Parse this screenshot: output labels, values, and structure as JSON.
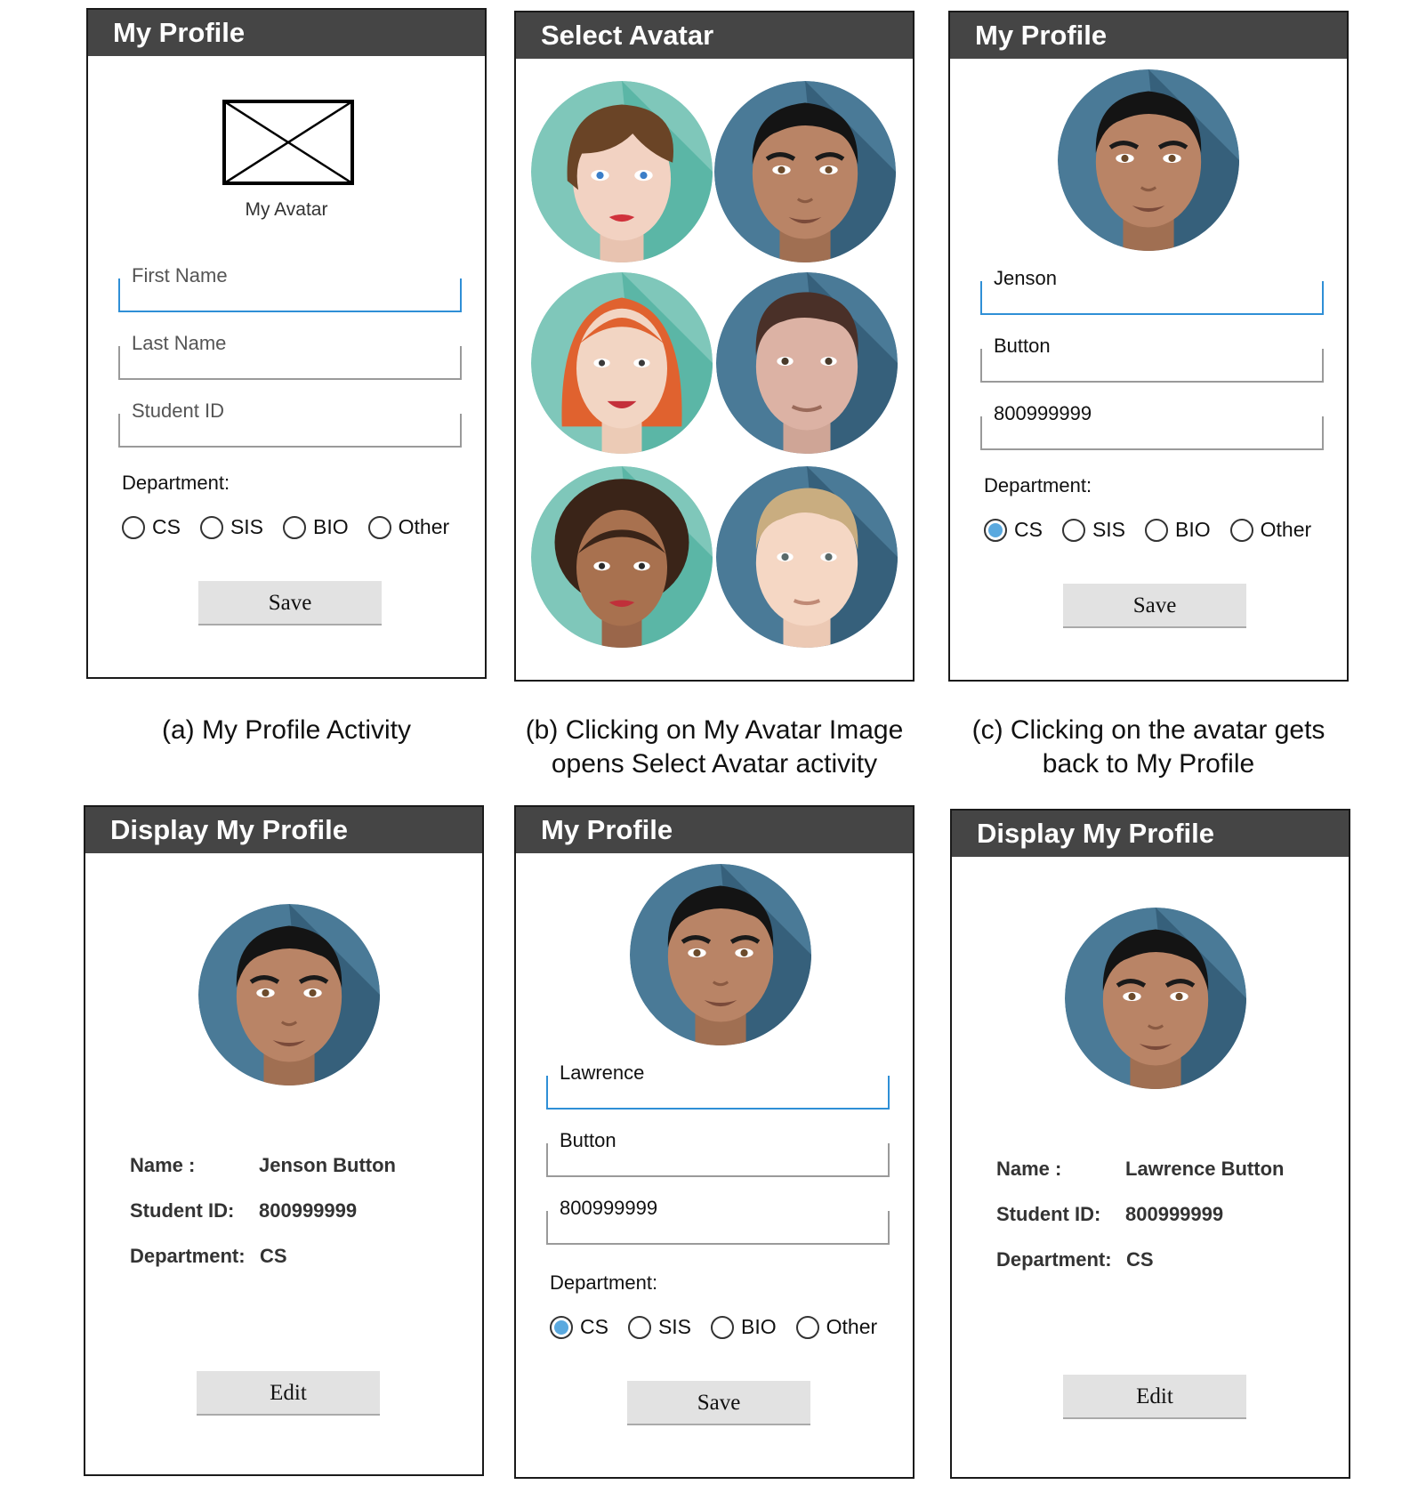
{
  "panels": {
    "a": {
      "title": "My Profile",
      "avatar_label": "My Avatar",
      "first_placeholder": "First Name",
      "last_placeholder": "Last Name",
      "id_placeholder": "Student ID",
      "dept_label": "Department:",
      "save": "Save"
    },
    "b": {
      "title": "Select Avatar"
    },
    "c": {
      "title": "My Profile",
      "first": "Jenson",
      "last": "Button",
      "id": "800999999",
      "dept_label": "Department:",
      "save": "Save",
      "selected_dept": "CS"
    },
    "d": {
      "title": "Display My Profile",
      "name_label": "Name :",
      "name": "Jenson Button",
      "id_label": "Student ID:",
      "id": "800999999",
      "dept_label": "Department:",
      "dept": "CS",
      "edit": "Edit"
    },
    "e": {
      "title": "My Profile",
      "first": "Lawrence",
      "last": "Button",
      "id": "800999999",
      "dept_label": "Department:",
      "save": "Save",
      "selected_dept": "CS"
    },
    "f": {
      "title": "Display My Profile",
      "name_label": "Name :",
      "name": "Lawrence Button",
      "id_label": "Student ID:",
      "id": "800999999",
      "dept_label": "Department:",
      "dept": "CS",
      "edit": "Edit"
    }
  },
  "departments": [
    "CS",
    "SIS",
    "BIO",
    "Other"
  ],
  "captions": {
    "a": "(a) My Profile Activity",
    "b_line1": "(b) Clicking on My Avatar Image",
    "b_line2": "opens Select Avatar activity",
    "c_line1": "(c) Clicking on the avatar gets",
    "c_line2": "back to My Profile"
  },
  "colors": {
    "titlebar": "#454545",
    "focus": "#2f8fd6",
    "radio_on": "#5aa9df",
    "teal_bg": "#6cc5b6",
    "blue_bg": "#3f6f8c"
  }
}
